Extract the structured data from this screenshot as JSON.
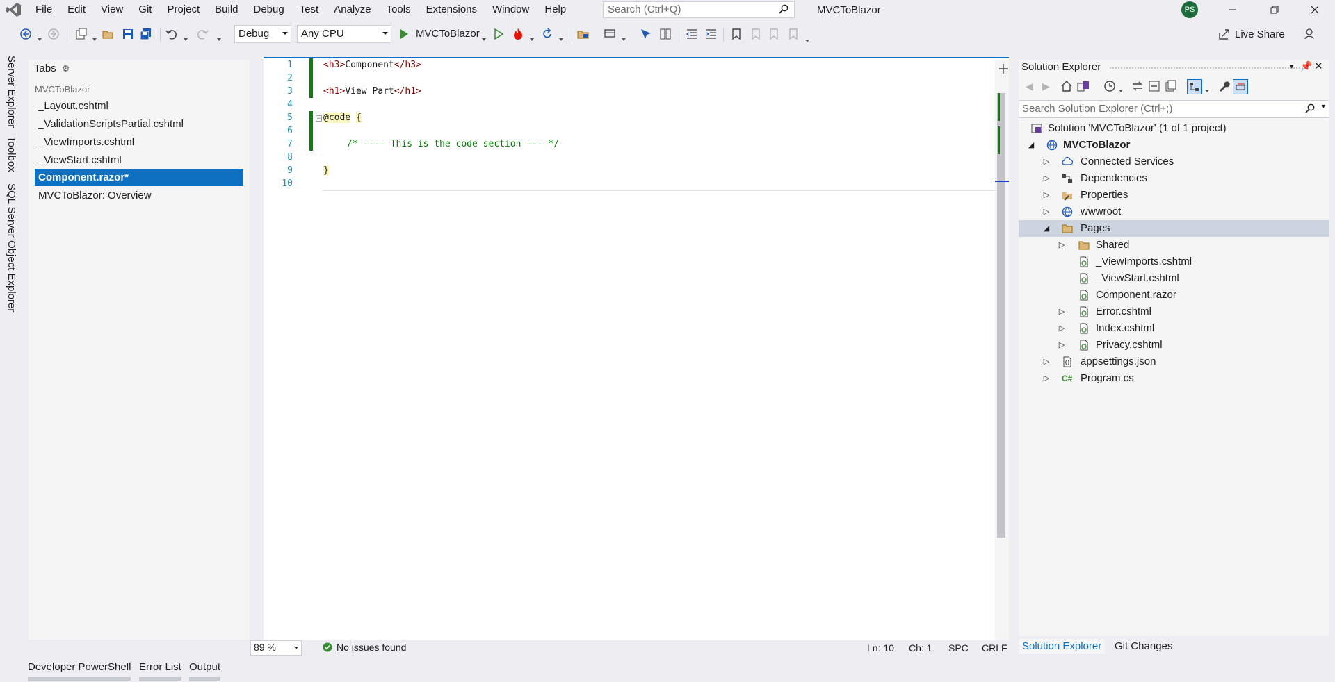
{
  "menu": {
    "items": [
      "File",
      "Edit",
      "View",
      "Git",
      "Project",
      "Build",
      "Debug",
      "Test",
      "Analyze",
      "Tools",
      "Extensions",
      "Window",
      "Help"
    ],
    "search_placeholder": "Search (Ctrl+Q)",
    "app_title": "MVCToBlazor",
    "avatar_initials": "PS"
  },
  "toolbar": {
    "config": "Debug",
    "platform": "Any CPU",
    "run_target": "MVCToBlazor",
    "live_share": "Live Share"
  },
  "left_strip": {
    "tabs": [
      "Server Explorer",
      "Toolbox",
      "SQL Server Object Explorer"
    ]
  },
  "tabs_panel": {
    "title": "Tabs",
    "group": "MVCToBlazor",
    "items": [
      {
        "label": "_Layout.cshtml",
        "selected": false
      },
      {
        "label": "_ValidationScriptsPartial.cshtml",
        "selected": false
      },
      {
        "label": "_ViewImports.cshtml",
        "selected": false
      },
      {
        "label": "_ViewStart.cshtml",
        "selected": false
      },
      {
        "label": "Component.razor*",
        "selected": true
      },
      {
        "label": "MVCToBlazor: Overview",
        "selected": false
      }
    ]
  },
  "editor": {
    "line_numbers": [
      "1",
      "2",
      "3",
      "4",
      "5",
      "6",
      "7",
      "8",
      "9",
      "10"
    ],
    "lines": {
      "l1": {
        "open": "<h3>",
        "text": "Component",
        "close": "</h3>"
      },
      "l3": {
        "open": "<h1>",
        "text": "View Part",
        "close": "</h1>"
      },
      "l5": {
        "kw": "@code",
        "brace": "{"
      },
      "l7": {
        "comment": "/* ---- This is the code section --- */"
      },
      "l9": {
        "brace": "}"
      }
    },
    "zoom": "89 %",
    "issues": "No issues found",
    "ln": "Ln: 10",
    "ch": "Ch: 1",
    "spc": "SPC",
    "crlf": "CRLF"
  },
  "solution_explorer": {
    "title": "Solution Explorer",
    "search_placeholder": "Search Solution Explorer (Ctrl+;)",
    "tree": {
      "solution": "Solution 'MVCToBlazor' (1 of 1 project)",
      "project": "MVCToBlazor",
      "connected_services": "Connected Services",
      "dependencies": "Dependencies",
      "properties": "Properties",
      "wwwroot": "wwwroot",
      "pages": "Pages",
      "shared": "Shared",
      "viewimports": "_ViewImports.cshtml",
      "viewstart": "_ViewStart.cshtml",
      "component": "Component.razor",
      "error": "Error.cshtml",
      "index": "Index.cshtml",
      "privacy": "Privacy.cshtml",
      "appsettings": "appsettings.json",
      "program": "Program.cs"
    },
    "bottom_tabs": [
      "Solution Explorer",
      "Git Changes"
    ]
  },
  "bottom_tabs": [
    "Developer PowerShell",
    "Error List",
    "Output"
  ],
  "colors": {
    "accent": "#0e70c0",
    "chrome": "#eeeef2",
    "change_bar": "#107c10",
    "selected_tree": "#ccd4e0"
  }
}
